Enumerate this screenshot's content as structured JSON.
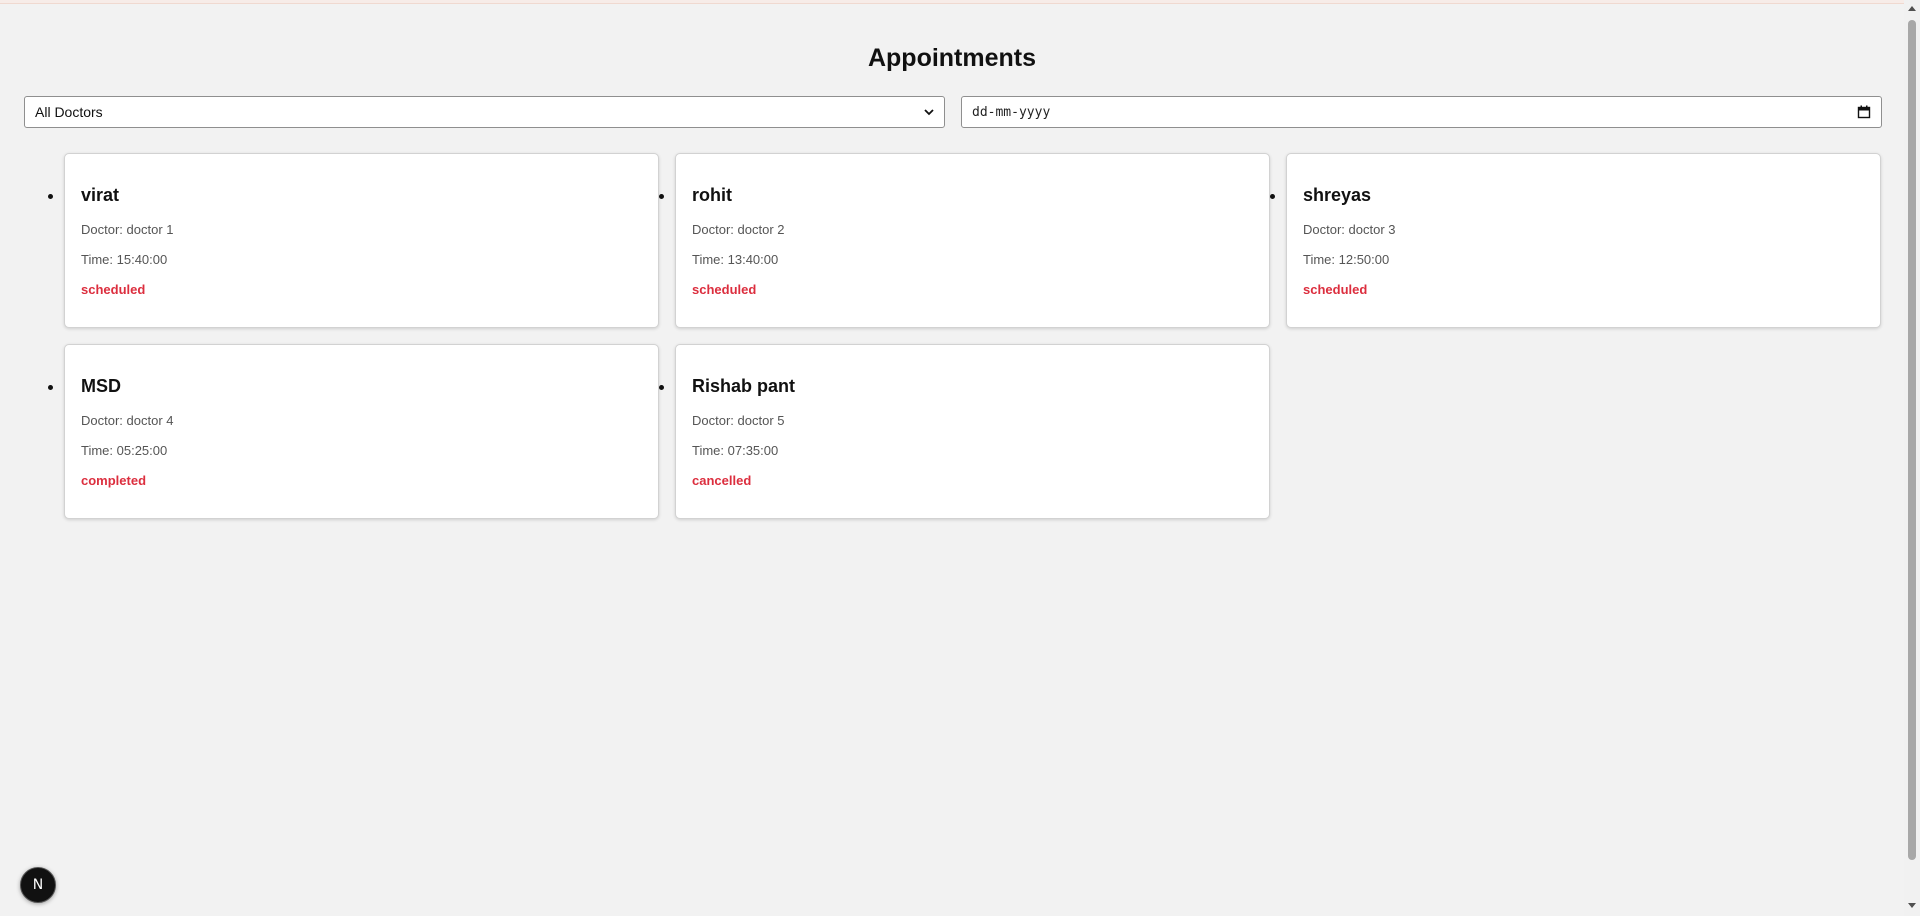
{
  "page": {
    "title": "Appointments"
  },
  "filters": {
    "doctor_select_value": "All Doctors",
    "date_placeholder": "dd-mm-yyyy"
  },
  "appointments": [
    {
      "patient": "virat",
      "doctor": "Doctor: doctor 1",
      "time": "Time: 15:40:00",
      "status": "scheduled"
    },
    {
      "patient": "rohit",
      "doctor": "Doctor: doctor 2",
      "time": "Time: 13:40:00",
      "status": "scheduled"
    },
    {
      "patient": "shreyas",
      "doctor": "Doctor: doctor 3",
      "time": "Time: 12:50:00",
      "status": "scheduled"
    },
    {
      "patient": "MSD",
      "doctor": "Doctor: doctor 4",
      "time": "Time: 05:25:00",
      "status": "completed"
    },
    {
      "patient": "Rishab pant",
      "doctor": "Doctor: doctor 5",
      "time": "Time: 07:35:00",
      "status": "cancelled"
    }
  ],
  "colors": {
    "status": "#dc2e3e",
    "background": "#f2f2f2"
  },
  "icons": {
    "select": "chevron-down-icon",
    "date": "calendar-icon",
    "dev_badge": "nextjs-logo-icon"
  },
  "dev_badge": {
    "letter": "N"
  }
}
